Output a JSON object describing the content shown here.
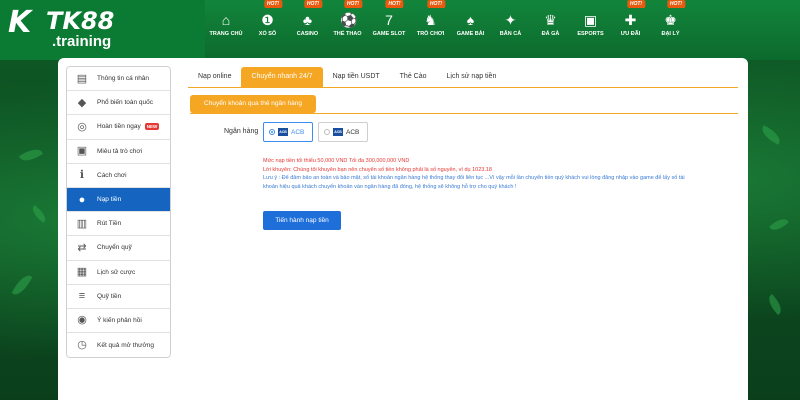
{
  "brand": {
    "logo_text": "TK88",
    "subtitle": ".training"
  },
  "nav": {
    "items": [
      {
        "label": "TRANG CHỦ",
        "icon": "home-icon",
        "hot": false
      },
      {
        "label": "XỔ SỐ",
        "icon": "lottery-icon",
        "hot": true
      },
      {
        "label": "CASINO",
        "icon": "casino-icon",
        "hot": true
      },
      {
        "label": "THỂ THAO",
        "icon": "soccer-icon",
        "hot": true
      },
      {
        "label": "GAME SLOT",
        "icon": "slot-icon",
        "hot": true
      },
      {
        "label": "TRÒ CHƠI",
        "icon": "chess-icon",
        "hot": true
      },
      {
        "label": "GAME BÀI",
        "icon": "cards-icon",
        "hot": false
      },
      {
        "label": "BẮN CÁ",
        "icon": "fish-icon",
        "hot": false
      },
      {
        "label": "ĐÁ GÀ",
        "icon": "rooster-icon",
        "hot": false
      },
      {
        "label": "ESPORTS",
        "icon": "gamepad-icon",
        "hot": false
      },
      {
        "label": "ƯU ĐÃI",
        "icon": "gift-icon",
        "hot": true
      },
      {
        "label": "ĐẠI LÝ",
        "icon": "agent-icon",
        "hot": true
      }
    ],
    "hot_label": "HOT!"
  },
  "sidebar": {
    "items": [
      {
        "label": "Thông tin cá nhân",
        "icon": "id-card-icon"
      },
      {
        "label": "Phổ biến toàn quốc",
        "icon": "diamond-icon"
      },
      {
        "label": "Hoàn tiền ngay",
        "icon": "refund-icon",
        "badge": "NEW"
      },
      {
        "label": "Miêu tả trò chơi",
        "icon": "gamepad-icon"
      },
      {
        "label": "Cách chơi",
        "icon": "info-icon"
      },
      {
        "label": "Nạp tiền",
        "icon": "piggy-bank-icon",
        "active": true
      },
      {
        "label": "Rút Tiền",
        "icon": "withdraw-icon"
      },
      {
        "label": "Chuyển quỹ",
        "icon": "transfer-icon"
      },
      {
        "label": "Lịch sử cược",
        "icon": "history-icon"
      },
      {
        "label": "Quỹ tiền",
        "icon": "coins-icon"
      },
      {
        "label": "Ý kiến phản hồi",
        "icon": "chat-icon"
      },
      {
        "label": "Kết quả mở thưởng",
        "icon": "clock-icon"
      }
    ]
  },
  "main": {
    "tabs": [
      {
        "label": "Nạp online",
        "active": false
      },
      {
        "label": "Chuyển nhanh 24/7",
        "active": true
      },
      {
        "label": "Nạp tiền USDT",
        "active": false
      },
      {
        "label": "Thẻ Cào",
        "active": false
      },
      {
        "label": "Lịch sử nạp tiền",
        "active": false
      }
    ],
    "sub_tab": "Chuyển khoản qua thẻ ngân hàng",
    "bank_label": "Ngân hàng",
    "banks": [
      {
        "name": "ACB",
        "logo": "ACB",
        "selected": true
      },
      {
        "name": "ACB",
        "logo": "ACB",
        "selected": false
      }
    ],
    "notes": [
      {
        "text": "Mức nạp tiền tối thiểu 50,000 VND Tối đa 300,000,000 VND",
        "color": "red"
      },
      {
        "text": "Lời khuyên: Chúng tôi khuyên bạn nên chuyển số tiền không phải là số nguyên, ví dụ 1023.18",
        "color": "red"
      },
      {
        "text": "Lưu ý : Để đảm bảo an toàn và bảo mật, số tài khoản ngân hàng hệ thống thay đổi liên tục ...Vì vậy mỗi lần chuyển tiền quý khách vui lòng đăng nhập vào game để lấy số tài",
        "color": "blue"
      },
      {
        "text": "khoản hiệu quả khách chuyển khoản vào ngân hàng đã đóng, hệ thống sẽ không hỗ trợ cho quý khách !",
        "color": "blue"
      }
    ],
    "submit_label": "Tiến hành nạp tiền"
  },
  "colors": {
    "header_green": "#0c6a2d",
    "tab_orange": "#f5a623",
    "active_blue": "#1565c0",
    "button_blue": "#1e6fd9",
    "warning_red": "#e53935",
    "note_blue": "#3a7bd5"
  }
}
